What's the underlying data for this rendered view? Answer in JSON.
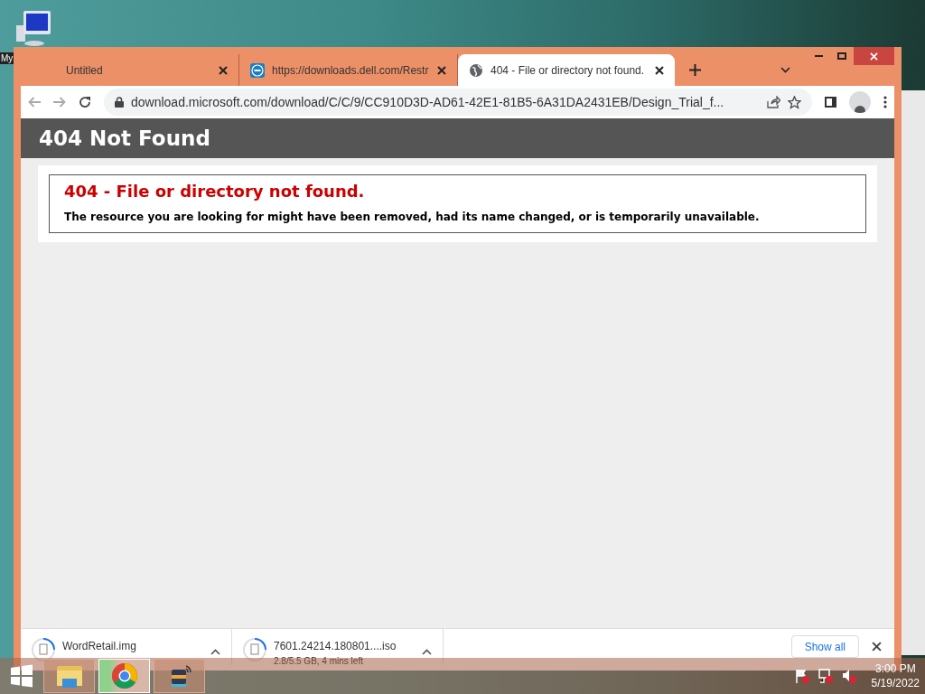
{
  "desktop": {
    "icon_label": "My"
  },
  "browser": {
    "tabs": [
      {
        "title": "Untitled",
        "kind": "none",
        "selected": false
      },
      {
        "title": "https://downloads.dell.com/Restr",
        "kind": "dell",
        "selected": false
      },
      {
        "title": "404 - File or directory not found.",
        "kind": "globe",
        "selected": true
      }
    ],
    "address": "download.microsoft.com/download/C/C/9/CC910D3D-AD61-42E1-81B5-6A31DA2431EB/Design_Trial_f...",
    "page": {
      "header": "404 Not Found",
      "error_title": "404 - File or directory not found.",
      "error_message": "The resource you are looking for might have been removed, had its name changed, or is temporarily unavailable."
    },
    "downloads": [
      {
        "name": "WordRetail.img"
      },
      {
        "name": "7601.24214.180801....iso",
        "status": "2.8/5.5 GB, 4 mins left"
      }
    ],
    "show_all": "Show all"
  },
  "taskbar": {
    "apps": [
      {
        "kind": "explorer",
        "selected": false
      },
      {
        "kind": "chrome",
        "selected": true
      },
      {
        "kind": "toolbox",
        "selected": false
      }
    ],
    "time": "3:00 PM",
    "date": "5/19/2022"
  }
}
